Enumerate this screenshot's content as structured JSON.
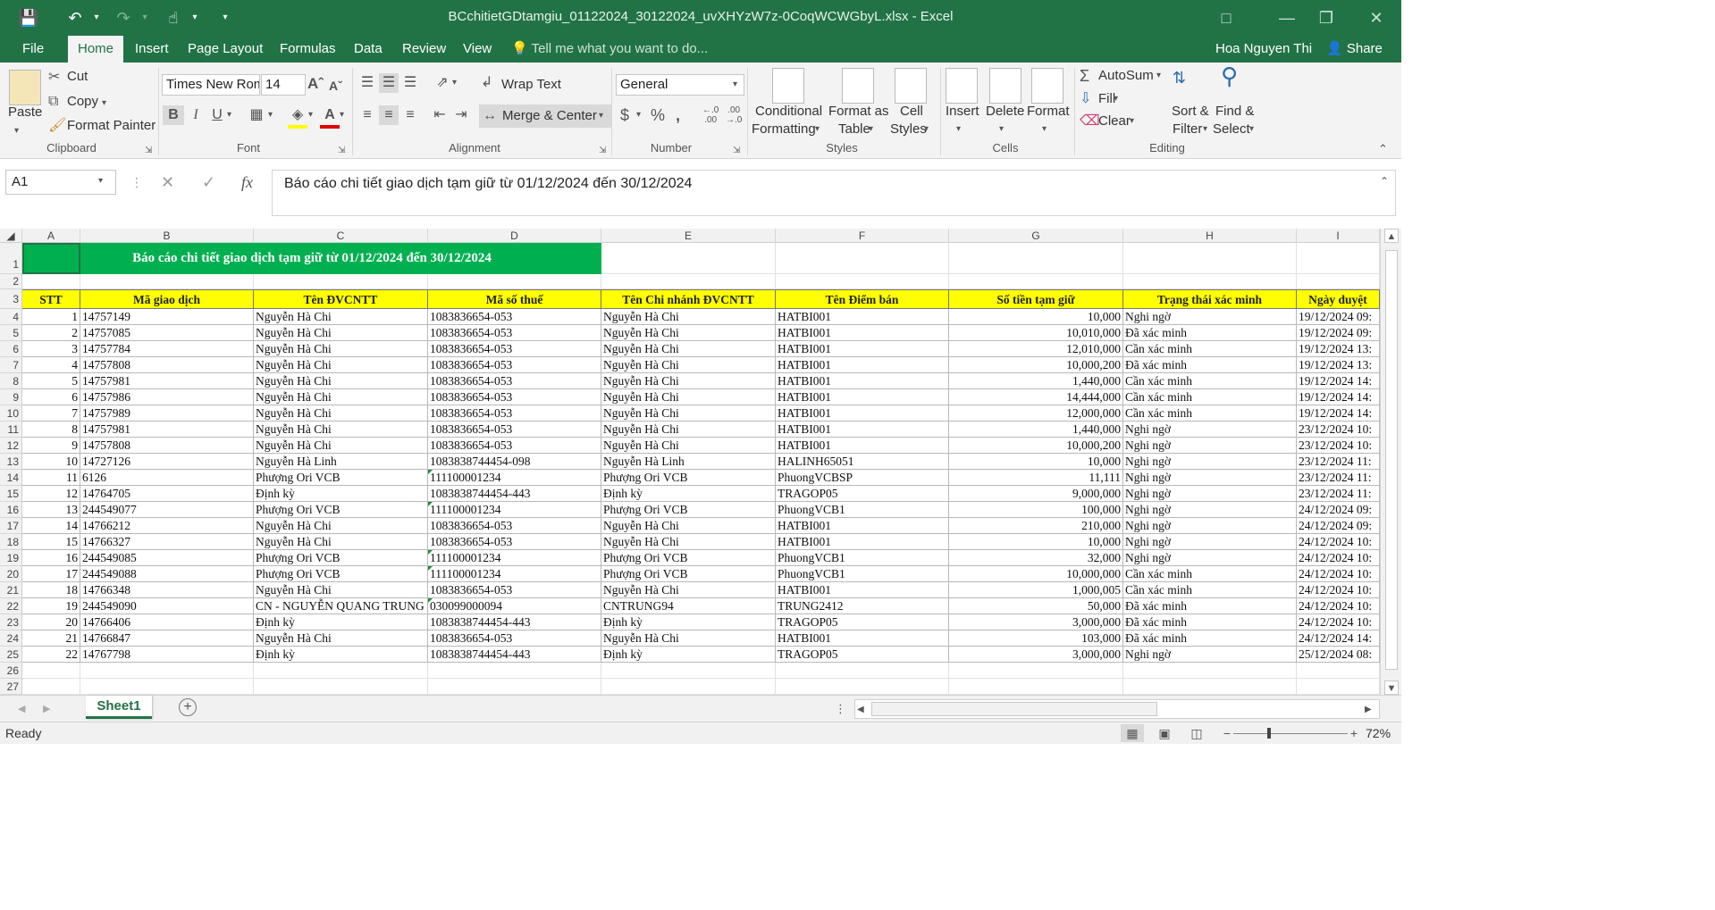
{
  "window": {
    "title": "BCchitietGDtamgiu_01122024_30122024_uvXHYzW7z-0CoqWCWGbyL.xlsx - Excel",
    "user": "Hoa Nguyen Thi",
    "share_label": "Share"
  },
  "tabs": [
    "File",
    "Home",
    "Insert",
    "Page Layout",
    "Formulas",
    "Data",
    "Review",
    "View"
  ],
  "tell_me": "Tell me what you want to do...",
  "ribbon": {
    "clipboard": {
      "paste": "Paste",
      "cut": "Cut",
      "copy": "Copy",
      "format_painter": "Format Painter",
      "label": "Clipboard"
    },
    "font": {
      "name": "Times New Roman",
      "size": "14",
      "label": "Font"
    },
    "alignment": {
      "wrap_text": "Wrap Text",
      "merge_center": "Merge & Center",
      "label": "Alignment"
    },
    "number": {
      "format": "General",
      "label": "Number"
    },
    "styles": {
      "conditional": "Conditional",
      "conditional2": "Formatting",
      "format_as": "Format as",
      "table": "Table",
      "cell": "Cell",
      "styles2": "Styles",
      "label": "Styles"
    },
    "cells": {
      "insert": "Insert",
      "delete": "Delete",
      "format": "Format",
      "label": "Cells"
    },
    "editing": {
      "autosum": "AutoSum",
      "fill": "Fill",
      "clear": "Clear",
      "sort": "Sort &",
      "filter": "Filter",
      "find": "Find &",
      "select": "Select",
      "label": "Editing"
    }
  },
  "formula_bar": {
    "name_box": "A1",
    "formula": "Báo cáo chi tiết giao dịch tạm giữ từ 01/12/2024 đến 30/12/2024"
  },
  "sheet": {
    "columns": [
      "A",
      "B",
      "C",
      "D",
      "E",
      "F",
      "G",
      "H",
      "I"
    ],
    "row_numbers": [
      "1",
      "2",
      "3",
      "4",
      "5",
      "6",
      "7",
      "8",
      "9",
      "10",
      "11",
      "12",
      "13",
      "14",
      "15",
      "16",
      "17",
      "18",
      "19",
      "20",
      "21",
      "22",
      "23",
      "24",
      "25",
      "26",
      "27"
    ],
    "title": "Báo cáo chi tiết giao dịch tạm giữ từ 01/12/2024 đến 30/12/2024",
    "headers": [
      "STT",
      "Mã giao dịch",
      "Tên ĐVCNTT",
      "Mã số thuế",
      "Tên Chi nhánh ĐVCNTT",
      "Tên Điểm bán",
      "Số tiền tạm giữ",
      "Trạng thái xác minh",
      "Ngày duyệt"
    ],
    "rows": [
      [
        "1",
        "14757149",
        "Nguyễn Hà Chi",
        "1083836654-053",
        "Nguyễn Hà Chi",
        "HATBI001",
        "10,000",
        "Nghi ngờ",
        "19/12/2024 09:"
      ],
      [
        "2",
        "14757085",
        "Nguyễn Hà Chi",
        "1083836654-053",
        "Nguyễn Hà Chi",
        "HATBI001",
        "10,010,000",
        "Đã xác minh",
        "19/12/2024 09:"
      ],
      [
        "3",
        "14757784",
        "Nguyễn Hà Chi",
        "1083836654-053",
        "Nguyễn Hà Chi",
        "HATBI001",
        "12,010,000",
        "Cần xác minh",
        "19/12/2024 13:"
      ],
      [
        "4",
        "14757808",
        "Nguyễn Hà Chi",
        "1083836654-053",
        "Nguyễn Hà Chi",
        "HATBI001",
        "10,000,200",
        "Đã xác minh",
        "19/12/2024 13:"
      ],
      [
        "5",
        "14757981",
        "Nguyễn Hà Chi",
        "1083836654-053",
        "Nguyễn Hà Chi",
        "HATBI001",
        "1,440,000",
        "Cần xác minh",
        "19/12/2024 14:"
      ],
      [
        "6",
        "14757986",
        "Nguyễn Hà Chi",
        "1083836654-053",
        "Nguyễn Hà Chi",
        "HATBI001",
        "14,444,000",
        "Cần xác minh",
        "19/12/2024 14:"
      ],
      [
        "7",
        "14757989",
        "Nguyễn Hà Chi",
        "1083836654-053",
        "Nguyễn Hà Chi",
        "HATBI001",
        "12,000,000",
        "Cần xác minh",
        "19/12/2024 14:"
      ],
      [
        "8",
        "14757981",
        "Nguyễn Hà Chi",
        "1083836654-053",
        "Nguyễn Hà Chi",
        "HATBI001",
        "1,440,000",
        "Nghi ngờ",
        "23/12/2024 10:"
      ],
      [
        "9",
        "14757808",
        "Nguyễn Hà Chi",
        "1083836654-053",
        "Nguyễn Hà Chi",
        "HATBI001",
        "10,000,200",
        "Nghi ngờ",
        "23/12/2024 10:"
      ],
      [
        "10",
        "14727126",
        "Nguyễn Hà Linh",
        "1083838744454-098",
        "Nguyễn Hà Linh",
        "HALINH65051",
        "10,000",
        "Nghi ngờ",
        "23/12/2024 11:"
      ],
      [
        "11",
        "6126",
        "Phượng Ori VCB",
        "111100001234",
        "Phượng Ori VCB",
        "PhuongVCBSP",
        "11,111",
        "Nghi ngờ",
        "23/12/2024 11:"
      ],
      [
        "12",
        "14764705",
        "Định kỳ",
        "1083838744454-443",
        "Định kỳ",
        "TRAGOP05",
        "9,000,000",
        "Nghi ngờ",
        "23/12/2024 11:"
      ],
      [
        "13",
        "244549077",
        "Phượng Ori VCB",
        "111100001234",
        "Phượng Ori VCB",
        "PhuongVCB1",
        "100,000",
        "Nghi ngờ",
        "24/12/2024 09:"
      ],
      [
        "14",
        "14766212",
        "Nguyễn Hà Chi",
        "1083836654-053",
        "Nguyễn Hà Chi",
        "HATBI001",
        "210,000",
        "Nghi ngờ",
        "24/12/2024 09:"
      ],
      [
        "15",
        "14766327",
        "Nguyễn Hà Chi",
        "1083836654-053",
        "Nguyễn Hà Chi",
        "HATBI001",
        "10,000",
        "Nghi ngờ",
        "24/12/2024 10:"
      ],
      [
        "16",
        "244549085",
        "Phượng Ori VCB",
        "111100001234",
        "Phượng Ori VCB",
        "PhuongVCB1",
        "32,000",
        "Nghi ngờ",
        "24/12/2024 10:"
      ],
      [
        "17",
        "244549088",
        "Phượng Ori VCB",
        "111100001234",
        "Phượng Ori VCB",
        "PhuongVCB1",
        "10,000,000",
        "Cần xác minh",
        "24/12/2024 10:"
      ],
      [
        "18",
        "14766348",
        "Nguyễn Hà Chi",
        "1083836654-053",
        "Nguyễn Hà Chi",
        "HATBI001",
        "1,000,005",
        "Cần xác minh",
        "24/12/2024 10:"
      ],
      [
        "19",
        "244549090",
        "CN - NGUYỄN QUANG TRUNG",
        "030099000094",
        "CNTRUNG94",
        "TRUNG2412",
        "50,000",
        "Đã xác minh",
        "24/12/2024 10:"
      ],
      [
        "20",
        "14766406",
        "Định kỳ",
        "1083838744454-443",
        "Định kỳ",
        "TRAGOP05",
        "3,000,000",
        "Đã xác minh",
        "24/12/2024 10:"
      ],
      [
        "21",
        "14766847",
        "Nguyễn Hà Chi",
        "1083836654-053",
        "Nguyễn Hà Chi",
        "HATBI001",
        "103,000",
        "Đã xác minh",
        "24/12/2024 14:"
      ],
      [
        "22",
        "14767798",
        "Định kỳ",
        "1083838744454-443",
        "Định kỳ",
        "TRAGOP05",
        "3,000,000",
        "Nghi ngờ",
        "25/12/2024 08:"
      ]
    ]
  },
  "sheet_tab": "Sheet1",
  "status": {
    "ready": "Ready",
    "zoom": "72%"
  },
  "colors": {
    "excel_green": "#217346",
    "title_fill": "#00b050",
    "header_fill": "#ffff00"
  }
}
